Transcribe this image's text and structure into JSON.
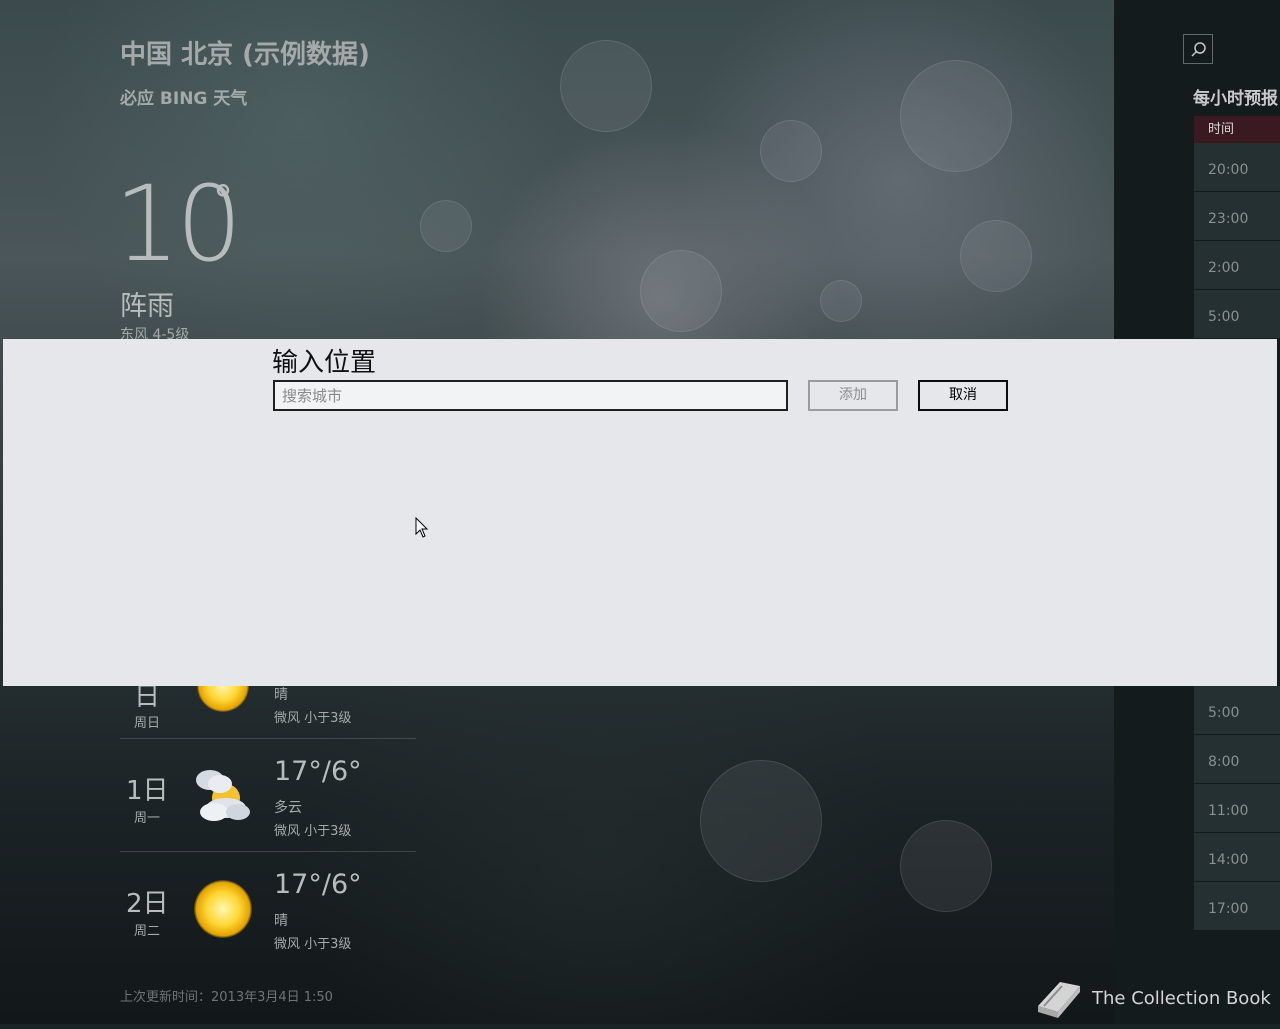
{
  "colors": {
    "dialog_bg": "#e6e7eb",
    "hourly_header": "#3a1a20",
    "panel_bg": "#141b1d"
  },
  "header": {
    "city": "中国 北京 (示例数据)",
    "brand": "必应 BING 天气"
  },
  "current": {
    "temp": "10",
    "degree": "°",
    "condition": "阵雨",
    "wind": "东风 4-5级"
  },
  "side": {
    "search_icon": "search-icon",
    "hourly_title": "每小时预报",
    "hourly_header": "时间",
    "hourly_times": [
      "20:00",
      "23:00",
      "2:00",
      "5:00",
      "5:00",
      "8:00",
      "11:00",
      "14:00",
      "17:00"
    ]
  },
  "dialog": {
    "title": "输入位置",
    "search_placeholder": "搜索城市",
    "add_label": "添加",
    "cancel_label": "取消"
  },
  "forecast": [
    {
      "day": "日",
      "weekday": "周日",
      "temp": "",
      "condition": "晴",
      "wind": "微风 小于3级",
      "icon": "sun-icon"
    },
    {
      "day": "1日",
      "weekday": "周一",
      "temp": "17°/6°",
      "condition": "多云",
      "wind": "微风 小于3级",
      "icon": "cloud-sun-icon"
    },
    {
      "day": "2日",
      "weekday": "周二",
      "temp": "17°/6°",
      "condition": "晴",
      "wind": "微风 小于3级",
      "icon": "sun-icon"
    }
  ],
  "footer": {
    "updated": "上次更新时间：2013年3月4日 1:50"
  },
  "watermark": {
    "text": "The Collection Book",
    "icon": "book-icon"
  }
}
